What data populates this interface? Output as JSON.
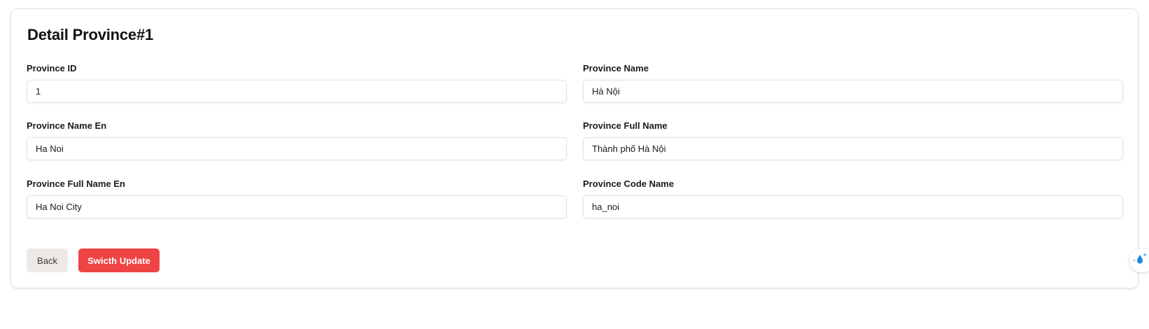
{
  "page": {
    "title": "Detail Province#1"
  },
  "form": {
    "province_id": {
      "label": "Province ID",
      "value": "1"
    },
    "province_name": {
      "label": "Province Name",
      "value": "Hà Nội"
    },
    "province_name_en": {
      "label": "Province Name En",
      "value": "Ha Noi"
    },
    "province_full_name": {
      "label": "Province Full Name",
      "value": "Thành phố Hà Nội"
    },
    "province_full_name_en": {
      "label": "Province Full Name En",
      "value": "Ha Noi City"
    },
    "province_code_name": {
      "label": "Province Code Name",
      "value": "ha_noi"
    }
  },
  "actions": {
    "back_label": "Back",
    "update_label": "Swicth Update"
  },
  "colors": {
    "primary_red": "#ef4444",
    "back_bg": "#ece9e6",
    "widget_blue": "#1e88e5"
  },
  "icons": {
    "floating_widget": "water-drop-sparkle-icon"
  }
}
